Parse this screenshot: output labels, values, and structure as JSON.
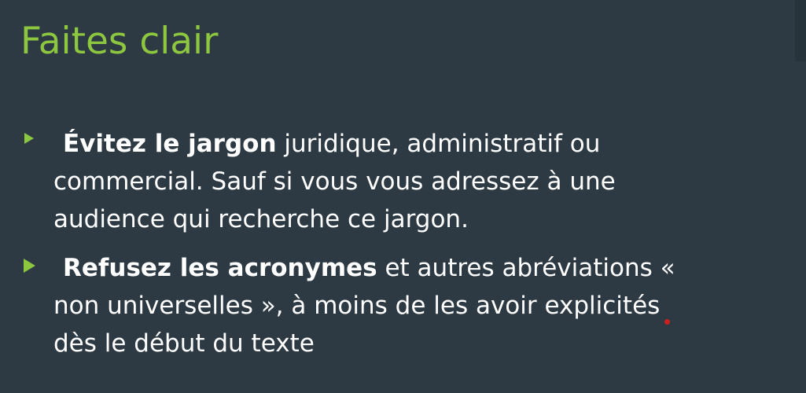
{
  "slide": {
    "title": "Faites clair",
    "accent_color": "#8dc63f",
    "background_color": "#2d3a43",
    "bullets": [
      {
        "bold": "Évitez le jargon",
        "rest_line1": " juridique, administratif ou",
        "line2": "commercial. Sauf si vous vous adressez à une",
        "line3": "audience qui recherche ce jargon.",
        "marker_icon": "triangle-bullet-icon"
      },
      {
        "bold": "Refusez les acronymes",
        "rest_line1": " et autres abréviations «",
        "line2": "non universelles », à moins de les avoir explicités",
        "line3": "dès le début du texte",
        "marker_icon": "triangle-bullet-icon"
      }
    ]
  }
}
